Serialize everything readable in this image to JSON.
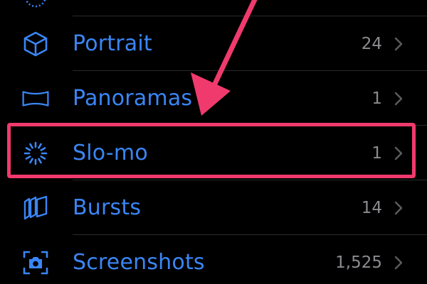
{
  "accent_color": "#3a86f5",
  "count_color": "#8b8b90",
  "annotation_color": "#f03a6d",
  "rows": [
    {
      "label": "Portrait",
      "count": "24",
      "icon": "cube-icon"
    },
    {
      "label": "Panoramas",
      "count": "1",
      "icon": "panorama-icon"
    },
    {
      "label": "Slo-mo",
      "count": "1",
      "icon": "slo-mo-icon",
      "highlighted": true
    },
    {
      "label": "Bursts",
      "count": "14",
      "icon": "bursts-icon"
    },
    {
      "label": "Screenshots",
      "count": "1,525",
      "icon": "screenshot-icon"
    }
  ]
}
